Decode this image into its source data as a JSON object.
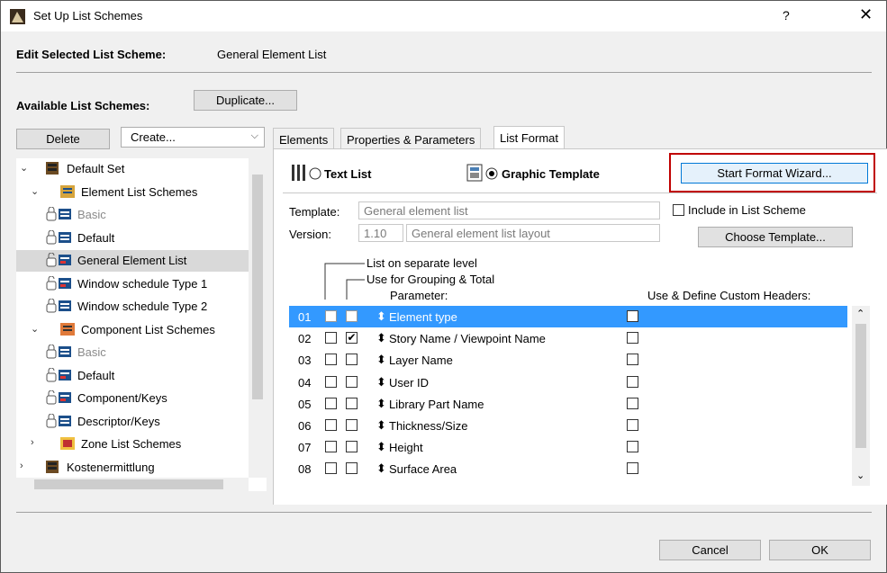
{
  "window": {
    "title": "Set Up List Schemes",
    "help": "?",
    "close": "✕"
  },
  "edit": {
    "label": "Edit Selected List Scheme:",
    "value": "General Element List"
  },
  "available": {
    "label": "Available List Schemes:",
    "duplicate": "Duplicate...",
    "delete": "Delete",
    "create": "Create..."
  },
  "tree": [
    {
      "label": "Default Set",
      "exp": "⌄",
      "icon": "set-icon",
      "muted": false,
      "selected": false
    },
    {
      "label": "Element List Schemes",
      "exp": "⌄",
      "icon": "element-list-icon",
      "muted": false,
      "selected": false
    },
    {
      "label": "Basic",
      "exp": "",
      "icon": "locked-list-icon",
      "muted": true,
      "selected": false
    },
    {
      "label": "Default",
      "exp": "",
      "icon": "locked-list-icon",
      "muted": false,
      "selected": false
    },
    {
      "label": "General Element List",
      "exp": "",
      "icon": "template-list-icon",
      "muted": false,
      "selected": true
    },
    {
      "label": "Window schedule Type 1",
      "exp": "",
      "icon": "template-list-icon",
      "muted": false,
      "selected": false
    },
    {
      "label": "Window schedule Type 2",
      "exp": "",
      "icon": "locked-list-icon",
      "muted": false,
      "selected": false
    },
    {
      "label": "Component List Schemes",
      "exp": "⌄",
      "icon": "component-list-icon",
      "muted": false,
      "selected": false
    },
    {
      "label": "Basic",
      "exp": "",
      "icon": "locked-list-icon",
      "muted": true,
      "selected": false
    },
    {
      "label": "Default",
      "exp": "",
      "icon": "template-list-icon",
      "muted": false,
      "selected": false
    },
    {
      "label": "Component/Keys",
      "exp": "",
      "icon": "template-list-icon",
      "muted": false,
      "selected": false
    },
    {
      "label": "Descriptor/Keys",
      "exp": "",
      "icon": "locked-list-icon",
      "muted": false,
      "selected": false
    },
    {
      "label": "Zone List Schemes",
      "exp": "›",
      "icon": "zone-list-icon",
      "muted": false,
      "selected": false
    },
    {
      "label": "Kostenermittlung",
      "exp": "›",
      "icon": "set-icon",
      "muted": false,
      "selected": false
    }
  ],
  "tabs": [
    "Elements",
    "Properties & Parameters",
    "List Format"
  ],
  "format": {
    "text_list": "Text List",
    "graphic_template": "Graphic Template",
    "wizard": "Start Format Wizard...",
    "template_label": "Template:",
    "template_value": "General element list",
    "version_label": "Version:",
    "version_num": "1.10",
    "version_value": "General element list layout",
    "include": "Include in List Scheme",
    "choose": "Choose Template...",
    "h_separate": "List on separate level",
    "h_grouping": "Use for Grouping & Total",
    "h_parameter": "Parameter:",
    "h_custom": "Use & Define Custom Headers:"
  },
  "params": [
    {
      "num": "01",
      "sep": true,
      "grp": true,
      "name": "Element type",
      "selected": true
    },
    {
      "num": "02",
      "sep": false,
      "grp": true,
      "name": "Story Name / Viewpoint Name",
      "selected": false
    },
    {
      "num": "03",
      "sep": false,
      "grp": false,
      "name": "Layer Name",
      "selected": false
    },
    {
      "num": "04",
      "sep": false,
      "grp": false,
      "name": "User ID",
      "selected": false
    },
    {
      "num": "05",
      "sep": false,
      "grp": false,
      "name": "Library Part Name",
      "selected": false
    },
    {
      "num": "06",
      "sep": false,
      "grp": false,
      "name": "Thickness/Size",
      "selected": false
    },
    {
      "num": "07",
      "sep": false,
      "grp": false,
      "name": "Height",
      "selected": false
    },
    {
      "num": "08",
      "sep": false,
      "grp": false,
      "name": "Surface Area",
      "selected": false
    }
  ],
  "footer": {
    "cancel": "Cancel",
    "ok": "OK"
  },
  "colors": {
    "selection": "#3399ff",
    "highlight_border": "#c00000",
    "wizard_border": "#0078d7"
  }
}
